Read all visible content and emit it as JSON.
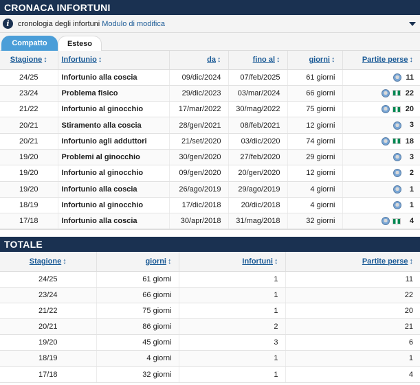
{
  "injury_section": {
    "title": "CRONACA INFORTUNI",
    "info_text": "cronologia degli infortuni",
    "info_link": "Modulo di modifica",
    "tabs": [
      {
        "label": "Compatto",
        "active": true
      },
      {
        "label": "Esteso",
        "active": false
      }
    ],
    "columns": {
      "season": "Stagione",
      "injury": "Infortunio",
      "from": "da",
      "until": "fino al",
      "days": "giorni",
      "games_missed": "Partite perse"
    },
    "sort_arrow": "↕",
    "rows": [
      {
        "season": "24/25",
        "injury": "Infortunio alla coscia",
        "from": "09/dic/2024",
        "until": "07/feb/2025",
        "days": "61 giorni",
        "games": "11",
        "badges": [
          "club"
        ]
      },
      {
        "season": "23/24",
        "injury": "Problema fisico",
        "from": "29/dic/2023",
        "until": "03/mar/2024",
        "days": "66 giorni",
        "games": "22",
        "badges": [
          "club",
          "flag"
        ]
      },
      {
        "season": "21/22",
        "injury": "Infortunio al ginocchio",
        "from": "17/mar/2022",
        "until": "30/mag/2022",
        "days": "75 giorni",
        "games": "20",
        "badges": [
          "club",
          "flag"
        ]
      },
      {
        "season": "20/21",
        "injury": "Stiramento alla coscia",
        "from": "28/gen/2021",
        "until": "08/feb/2021",
        "days": "12 giorni",
        "games": "3",
        "badges": [
          "club"
        ]
      },
      {
        "season": "20/21",
        "injury": "Infortunio agli adduttori",
        "from": "21/set/2020",
        "until": "03/dic/2020",
        "days": "74 giorni",
        "games": "18",
        "badges": [
          "club",
          "flag"
        ]
      },
      {
        "season": "19/20",
        "injury": "Problemi al ginocchio",
        "from": "30/gen/2020",
        "until": "27/feb/2020",
        "days": "29 giorni",
        "games": "3",
        "badges": [
          "club"
        ]
      },
      {
        "season": "19/20",
        "injury": "Infortunio al ginocchio",
        "from": "09/gen/2020",
        "until": "20/gen/2020",
        "days": "12 giorni",
        "games": "2",
        "badges": [
          "club"
        ]
      },
      {
        "season": "19/20",
        "injury": "Infortunio alla coscia",
        "from": "26/ago/2019",
        "until": "29/ago/2019",
        "days": "4 giorni",
        "games": "1",
        "badges": [
          "club"
        ]
      },
      {
        "season": "18/19",
        "injury": "Infortunio al ginocchio",
        "from": "17/dic/2018",
        "until": "20/dic/2018",
        "days": "4 giorni",
        "games": "1",
        "badges": [
          "club"
        ]
      },
      {
        "season": "17/18",
        "injury": "Infortunio alla coscia",
        "from": "30/apr/2018",
        "until": "31/mag/2018",
        "days": "32 giorni",
        "games": "4",
        "badges": [
          "club",
          "flag"
        ]
      }
    ]
  },
  "totals_section": {
    "title": "TOTALE",
    "columns": {
      "season": "Stagione",
      "days": "giorni",
      "injuries": "Infortuni",
      "games_missed": "Partite perse"
    },
    "rows": [
      {
        "season": "24/25",
        "days": "61 giorni",
        "injuries": "1",
        "games": "11"
      },
      {
        "season": "23/24",
        "days": "66 giorni",
        "injuries": "1",
        "games": "22"
      },
      {
        "season": "21/22",
        "days": "75 giorni",
        "injuries": "1",
        "games": "20"
      },
      {
        "season": "20/21",
        "days": "86 giorni",
        "injuries": "2",
        "games": "21"
      },
      {
        "season": "19/20",
        "days": "45 giorni",
        "injuries": "3",
        "games": "6"
      },
      {
        "season": "18/19",
        "days": "4 giorni",
        "injuries": "1",
        "games": "1"
      },
      {
        "season": "17/18",
        "days": "32 giorni",
        "injuries": "1",
        "games": "4"
      }
    ]
  },
  "icons": {
    "info": "info-icon",
    "dropdown": "chevron-down-icon",
    "club_badge": "club-crest-icon",
    "national_team": "nigeria-flag-icon"
  },
  "colors": {
    "header_bar": "#1a3151",
    "link": "#1a5a96",
    "tab_active": "#4b9ed8"
  }
}
